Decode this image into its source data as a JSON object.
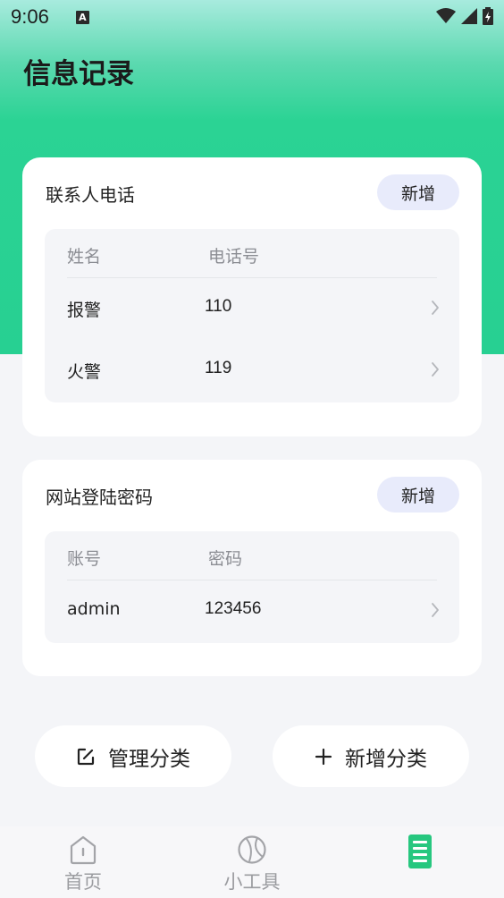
{
  "status_bar": {
    "time": "9:06",
    "notification_icon": "A"
  },
  "page": {
    "title": "信息记录"
  },
  "contacts_card": {
    "title": "联系人电话",
    "add_label": "新增",
    "columns": [
      "姓名",
      "电话号"
    ],
    "rows": [
      {
        "name": "报警",
        "value": "110"
      },
      {
        "name": "火警",
        "value": "119"
      }
    ]
  },
  "website_card": {
    "title": "网站登陆密码",
    "add_label": "新增",
    "columns": [
      "账号",
      "密码"
    ],
    "rows": [
      {
        "name": "admin",
        "value": "123456"
      }
    ]
  },
  "actions": {
    "manage_label": "管理分类",
    "add_category_label": "新增分类"
  },
  "tab_bar": {
    "items": [
      {
        "label": "首页",
        "icon": "home-icon"
      },
      {
        "label": "小工具",
        "icon": "ball-icon"
      },
      {
        "label": "",
        "icon": "records-icon"
      }
    ]
  },
  "colors": {
    "accent": "#27d092",
    "add_button_bg": "#e8ebfb",
    "page_bg": "#f4f5f8"
  }
}
